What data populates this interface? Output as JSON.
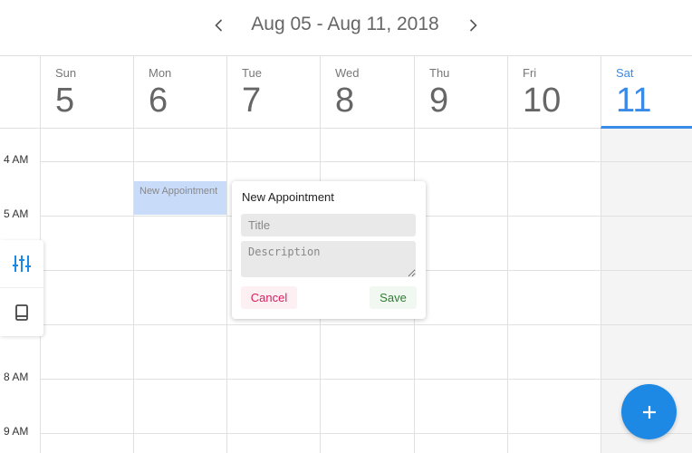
{
  "toolbar": {
    "date_range": "Aug 05 - Aug 11, 2018",
    "prev_icon": "chevron-left-icon",
    "next_icon": "chevron-right-icon"
  },
  "days": [
    {
      "name": "Sun",
      "date": "5",
      "today": false
    },
    {
      "name": "Mon",
      "date": "6",
      "today": false
    },
    {
      "name": "Tue",
      "date": "7",
      "today": false
    },
    {
      "name": "Wed",
      "date": "8",
      "today": false
    },
    {
      "name": "Thu",
      "date": "9",
      "today": false
    },
    {
      "name": "Fri",
      "date": "10",
      "today": false
    },
    {
      "name": "Sat",
      "date": "11",
      "today": true
    }
  ],
  "time_labels": [
    "4 AM",
    "5 AM",
    "8 AM",
    "9 AM"
  ],
  "appointment": {
    "text": "New Appointment"
  },
  "side_tools": {
    "filter_icon": "sliders-icon",
    "book_icon": "book-icon"
  },
  "popup": {
    "title": "New Appointment",
    "title_placeholder": "Title",
    "description_placeholder": "Description",
    "cancel_label": "Cancel",
    "save_label": "Save"
  },
  "fab_icon": "plus-icon",
  "colors": {
    "accent": "#3a8ae8",
    "fab": "#1e88e5",
    "cancel": "#d81b60",
    "save": "#2e7d32",
    "appointment": "#c8dbf9"
  }
}
